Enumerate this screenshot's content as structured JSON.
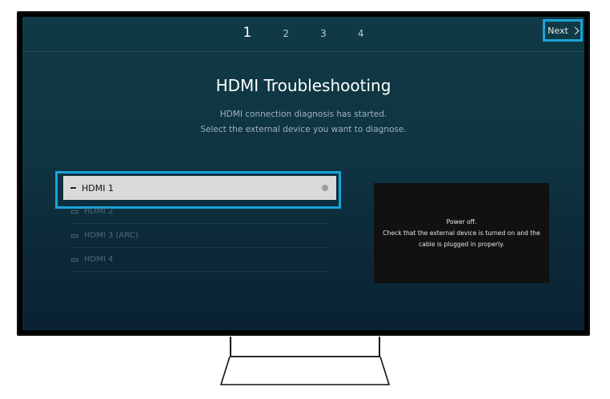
{
  "steps": [
    "1",
    "2",
    "3",
    "4"
  ],
  "active_step": "1",
  "next_button": {
    "label": "Next"
  },
  "title": "HDMI Troubleshooting",
  "subtitle": {
    "line1": "HDMI connection diagnosis has started.",
    "line2": "Select the external device you want to diagnose."
  },
  "hdmi_list": [
    {
      "label": "HDMI 1",
      "selected": true
    },
    {
      "label": "HDMI 2",
      "selected": false
    },
    {
      "label": "HDMI 3 (ARC)",
      "selected": false
    },
    {
      "label": "HDMI 4",
      "selected": false
    }
  ],
  "info_panel": {
    "line1": "Power off.",
    "line2": "Check that the external device is turned on and the",
    "line3": "cable is plugged in properly."
  },
  "colors": {
    "focus": "#1aa3d9",
    "background": "#0f3a45",
    "panel": "#111111"
  },
  "icons": [
    "chevron-right-icon",
    "hdmi-port-icon",
    "dash-icon",
    "status-dot-icon"
  ]
}
